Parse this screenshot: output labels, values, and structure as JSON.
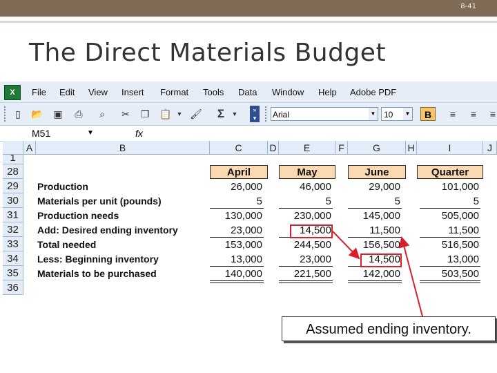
{
  "slide": {
    "number": "8-41",
    "title": "The Direct Materials Budget"
  },
  "excel": {
    "menu": [
      "File",
      "Edit",
      "View",
      "Insert",
      "Format",
      "Tools",
      "Data",
      "Window",
      "Help",
      "Adobe PDF"
    ],
    "font_name": "Arial",
    "font_size": "10",
    "bold_label": "B",
    "sum_symbol": "Σ",
    "name_box": "M51",
    "fx_label": "fx",
    "columns": [
      "A",
      "B",
      "C",
      "D",
      "E",
      "F",
      "G",
      "H",
      "I",
      "J"
    ],
    "row_numbers": [
      "1",
      "28",
      "29",
      "30",
      "31",
      "32",
      "33",
      "34",
      "35",
      "36"
    ],
    "headers": {
      "april": "April",
      "may": "May",
      "june": "June",
      "quarter": "Quarter"
    },
    "rows": [
      {
        "label": "Production",
        "april": "26,000",
        "may": "46,000",
        "june": "29,000",
        "quarter": "101,000"
      },
      {
        "label": "Materials per unit (pounds)",
        "april": "5",
        "may": "5",
        "june": "5",
        "quarter": "5"
      },
      {
        "label": "Production needs",
        "april": "130,000",
        "may": "230,000",
        "june": "145,000",
        "quarter": "505,000"
      },
      {
        "label": "Add: Desired ending inventory",
        "april": "23,000",
        "may": "14,500",
        "june": "11,500",
        "quarter": "11,500"
      },
      {
        "label": "Total needed",
        "april": "153,000",
        "may": "244,500",
        "june": "156,500",
        "quarter": "516,500"
      },
      {
        "label": "Less: Beginning inventory",
        "april": "13,000",
        "may": "23,000",
        "june": "14,500",
        "quarter": "13,000"
      },
      {
        "label": "Materials to be purchased",
        "april": "140,000",
        "may": "221,500",
        "june": "142,000",
        "quarter": "503,500"
      }
    ]
  },
  "annotation": "Assumed ending inventory.",
  "colors": {
    "top_band": "#7f6b56",
    "excel_bar": "#e7edf6",
    "header_fill": "#fbd9b2",
    "highlight": "#d9202a"
  }
}
